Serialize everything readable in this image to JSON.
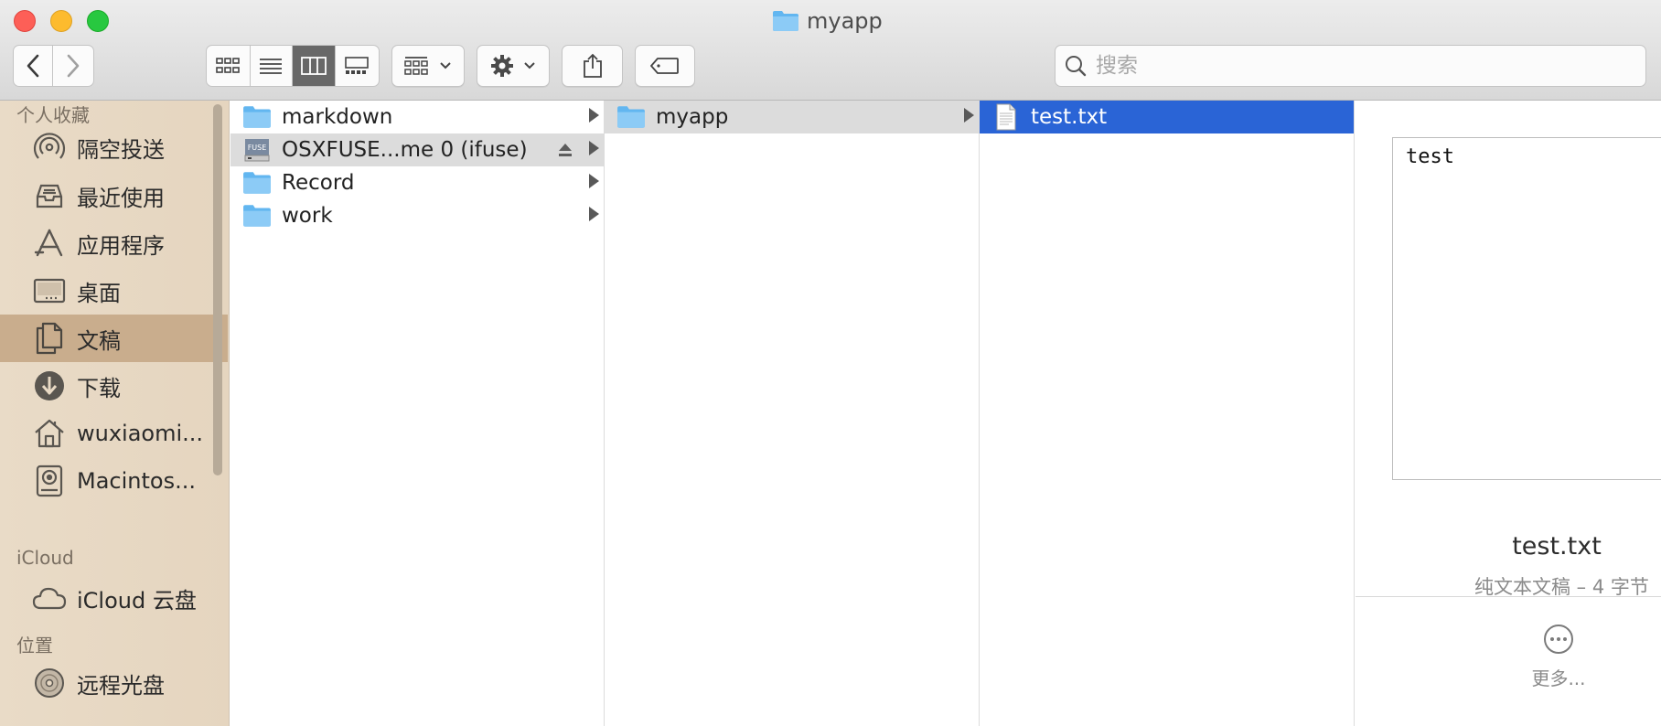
{
  "window": {
    "title": "myapp"
  },
  "toolbar": {
    "search_placeholder": "搜索"
  },
  "sidebar": {
    "favorites_header": "个人收藏",
    "favorites": [
      {
        "label": "隔空投送",
        "icon": "airdrop-icon"
      },
      {
        "label": "最近使用",
        "icon": "recents-icon"
      },
      {
        "label": "应用程序",
        "icon": "applications-icon"
      },
      {
        "label": "桌面",
        "icon": "desktop-icon"
      },
      {
        "label": "文稿",
        "icon": "documents-icon",
        "selected": true
      },
      {
        "label": "下载",
        "icon": "downloads-icon"
      },
      {
        "label": "wuxiaomi...",
        "icon": "home-icon"
      },
      {
        "label": "Macintos...",
        "icon": "hard-disk-icon"
      }
    ],
    "icloud_header": "iCloud",
    "icloud": [
      {
        "label": "iCloud 云盘",
        "icon": "cloud-icon"
      }
    ],
    "locations_header": "位置",
    "locations": [
      {
        "label": "远程光盘",
        "icon": "remote-disc-icon"
      }
    ]
  },
  "columns": {
    "col1": [
      {
        "label": "markdown",
        "icon": "folder-icon"
      },
      {
        "label": "OSXFUSE...me 0 (ifuse)",
        "icon": "fuse-volume-icon",
        "selected": true
      },
      {
        "label": "Record",
        "icon": "folder-icon"
      },
      {
        "label": "work",
        "icon": "folder-icon"
      }
    ],
    "col2": [
      {
        "label": "myapp",
        "icon": "folder-icon",
        "selected": true
      }
    ],
    "col3": [
      {
        "label": "test.txt",
        "icon": "text-file-icon",
        "selected": true
      }
    ]
  },
  "preview": {
    "content": "test",
    "file_name": "test.txt",
    "file_info": "纯文本文稿 – 4 字节",
    "more_label": "更多..."
  },
  "colors": {
    "selection_blue": "#2a64d6",
    "sidebar_selected": "#c9ad8d",
    "folder_blue": "#62b6f0"
  }
}
